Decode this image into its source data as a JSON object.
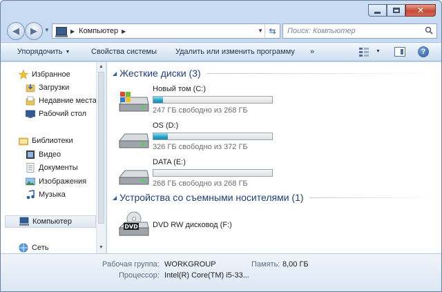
{
  "address": {
    "location": "Компьютер"
  },
  "search": {
    "placeholder": "Поиск: Компьютер"
  },
  "commands": {
    "organize": "Упорядочить",
    "system_properties": "Свойства системы",
    "uninstall": "Удалить или изменить программу",
    "more": "»"
  },
  "sidebar": {
    "favorites": "Избранное",
    "downloads": "Загрузки",
    "recent": "Недавние места",
    "desktop": "Рабочий стол",
    "libraries": "Библиотеки",
    "video": "Видео",
    "documents": "Документы",
    "images": "Изображения",
    "music": "Музыка",
    "computer": "Компьютер",
    "network": "Сеть"
  },
  "groups": {
    "hdd": "Жесткие диски (3)",
    "removable": "Устройства со съемными носителями (1)"
  },
  "drives": [
    {
      "name": "Новый том (C:)",
      "free": "247 ГБ свободно из 268 ГБ",
      "used_fraction": 0.08
    },
    {
      "name": "OS (D:)",
      "free": "326 ГБ свободно из 372 ГБ",
      "used_fraction": 0.12
    },
    {
      "name": "DATA (E:)",
      "free": "268 ГБ свободно из 268 ГБ",
      "used_fraction": 0.0
    }
  ],
  "dvd": {
    "name": "DVD RW дисковод (F:)",
    "badge": "DVD"
  },
  "details": {
    "workgroup_label": "Рабочая группа:",
    "workgroup_value": "WORKGROUP",
    "memory_label": "Память:",
    "memory_value": "8,00 ГБ",
    "cpu_label": "Процессор:",
    "cpu_value": "Intel(R) Core(TM) i5-33..."
  },
  "colors": {
    "accent": "#1e3d7a",
    "bar_fill": "#27a6c9",
    "chrome": "#c9dcf2"
  }
}
